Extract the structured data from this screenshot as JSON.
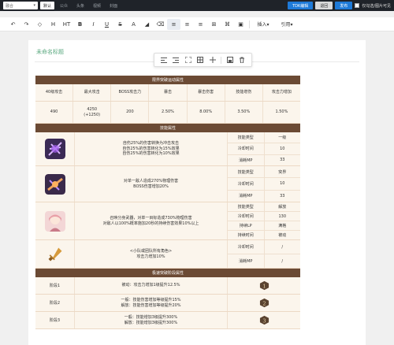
{
  "topbar": {
    "select_value": "融合",
    "tabs": [
      "默认",
      "公众",
      "头条",
      "视频",
      "封面"
    ],
    "active_tab": 0,
    "btn_tdk": "TDK编辑",
    "btn_back": "退回",
    "btn_publish": "发布",
    "checkbox_label": "仅勾选/图片可见"
  },
  "toolbar": {
    "items": [
      "↶",
      "↷",
      "◇",
      "H",
      "HT",
      "B",
      "I",
      "U",
      "S",
      "A",
      "◢",
      "⌫",
      "≡",
      "≡",
      "≡",
      "⊞",
      "⌘",
      "▣"
    ],
    "insert_label": "插入▾",
    "quote_label": "引用▾"
  },
  "doc": {
    "title": "未命名标题"
  },
  "table": {
    "section_stats": "限界突破运动属性",
    "stat_headers": [
      "40级攻击",
      "最大攻击",
      "BOSS攻击力",
      "暴击",
      "暴击伤害",
      "技能增伤",
      "攻击力增加"
    ],
    "stat_values": [
      "490",
      "4250\n(+1250)",
      "200",
      "2.50%",
      "8.00%",
      "3.50%",
      "1.50%"
    ],
    "section_skills": "技能属性",
    "skills": [
      {
        "desc": "自伤25%的伤害转换为冲击攻击\n自伤25%的伤害转化为15%效果\n自伤25%的伤害转化为10%效果",
        "attrs": [
          [
            "技能类型",
            "一级"
          ],
          [
            "冷却时间",
            "10"
          ],
          [
            "消耗MP",
            "33"
          ]
        ],
        "color": "#6e3aa8"
      },
      {
        "desc": "对单一敌人造成270%物理伤害\nBOSS伤害增加20%",
        "attrs": [
          [
            "技能类型",
            "突界"
          ],
          [
            "冷却时间",
            "10"
          ],
          [
            "消耗MP",
            "33"
          ]
        ],
        "color": "#b46a2a"
      },
      {
        "desc": "召唤分身武器，对单一目标造成730%物理伤害\n对敌人以100%概率施加20秒的持续伤害效果10%以上",
        "attrs": [
          [
            "技能类型",
            "解放"
          ],
          [
            "冷却时间",
            "130"
          ],
          [
            "持续LP",
            "满格"
          ],
          [
            "持续时间",
            "被动"
          ]
        ],
        "color": "#d79aa0"
      },
      {
        "desc": "<小队或团队所有角色>\n攻击力增加10%",
        "attrs": [
          [
            "冷却时间",
            "/"
          ],
          [
            "消耗MP",
            "/"
          ]
        ],
        "color": "#c8892e"
      }
    ],
    "section_stage": "极速突破阶段属性",
    "stages": [
      {
        "level": "阶段1",
        "text": "被动：攻击力增加1级提升12.5%",
        "badge": "1"
      },
      {
        "level": "阶段2",
        "text": "一般：技能伤害增加等级提升15%\n解放：技能伤害增加等级提升20%",
        "badge": "2"
      },
      {
        "level": "阶段3",
        "text": "一般：技能增加3级提升300%\n解放：技能增加3级提升300%",
        "badge": "3"
      }
    ]
  },
  "colors": {
    "accent": "#1e7ad8",
    "section": "#6b4a34",
    "row_bg": "#fbf5ec",
    "title_green": "#5aa87f"
  }
}
